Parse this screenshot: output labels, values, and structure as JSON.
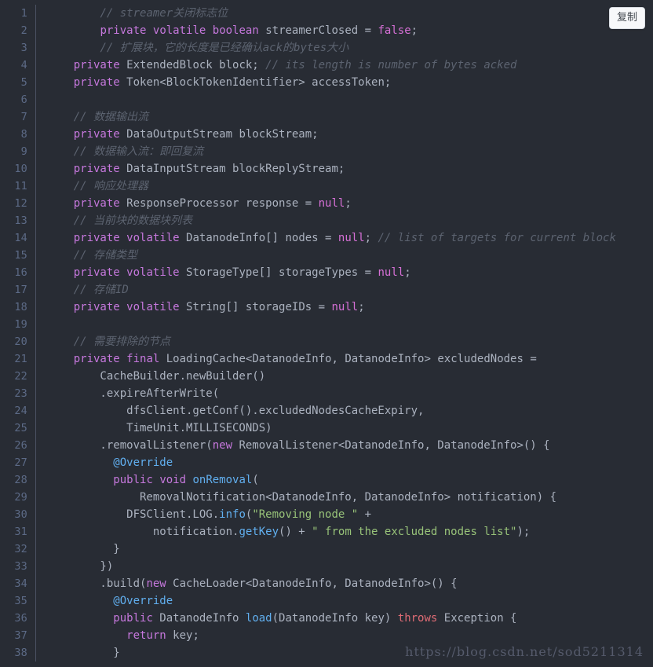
{
  "code_block": {
    "language": "java",
    "theme": {
      "background": "#282c34",
      "foreground": "#abb2bf",
      "gutter_text": "#5c6a86",
      "gutter_border": "#4b5263",
      "keyword": "#c678dd",
      "comment": "#5c6370",
      "string": "#98c379",
      "function": "#61afef",
      "annotation": "#61afef",
      "literal": "#d670d6"
    },
    "copy_button": {
      "label": "复制"
    },
    "watermark": {
      "text": "https://blog.csdn.net/sod5211314"
    },
    "line_numbers": [
      "1",
      "2",
      "3",
      "4",
      "5",
      "6",
      "7",
      "8",
      "9",
      "10",
      "11",
      "12",
      "13",
      "14",
      "15",
      "16",
      "17",
      "18",
      "19",
      "20",
      "21",
      "22",
      "23",
      "24",
      "25",
      "26",
      "27",
      "28",
      "29",
      "30",
      "31",
      "32",
      "33",
      "34",
      "35",
      "36",
      "37",
      "38"
    ],
    "lines": [
      "        // streamer关闭标志位",
      "        private volatile boolean streamerClosed = false;",
      "        // 扩展块，它的长度是已经确认ack的bytes大小",
      "    private ExtendedBlock block; // its length is number of bytes acked",
      "    private Token<BlockTokenIdentifier> accessToken;",
      "",
      "    // 数据输出流",
      "    private DataOutputStream blockStream;",
      "    // 数据输入流：即回复流",
      "    private DataInputStream blockReplyStream;",
      "    // 响应处理器",
      "    private ResponseProcessor response = null;",
      "    // 当前块的数据块列表",
      "    private volatile DatanodeInfo[] nodes = null; // list of targets for current block",
      "    // 存储类型",
      "    private volatile StorageType[] storageTypes = null;",
      "    // 存储ID",
      "    private volatile String[] storageIDs = null;",
      "",
      "    // 需要排除的节点",
      "    private final LoadingCache<DatanodeInfo, DatanodeInfo> excludedNodes =",
      "        CacheBuilder.newBuilder()",
      "        .expireAfterWrite(",
      "            dfsClient.getConf().excludedNodesCacheExpiry,",
      "            TimeUnit.MILLISECONDS)",
      "        .removalListener(new RemovalListener<DatanodeInfo, DatanodeInfo>() {",
      "          @Override",
      "          public void onRemoval(",
      "              RemovalNotification<DatanodeInfo, DatanodeInfo> notification) {",
      "            DFSClient.LOG.info(\"Removing node \" +",
      "                notification.getKey() + \" from the excluded nodes list\");",
      "          }",
      "        })",
      "        .build(new CacheLoader<DatanodeInfo, DatanodeInfo>() {",
      "          @Override",
      "          public DatanodeInfo load(DatanodeInfo key) throws Exception {",
      "            return key;",
      "          }"
    ],
    "tokens": [
      [
        {
          "t": "        ",
          "c": "plain"
        },
        {
          "t": "// streamer关闭标志位",
          "c": "cmt"
        }
      ],
      [
        {
          "t": "        ",
          "c": "plain"
        },
        {
          "t": "private",
          "c": "kw"
        },
        {
          "t": " ",
          "c": "plain"
        },
        {
          "t": "volatile",
          "c": "kw"
        },
        {
          "t": " ",
          "c": "plain"
        },
        {
          "t": "boolean",
          "c": "kw"
        },
        {
          "t": " streamerClosed = ",
          "c": "plain"
        },
        {
          "t": "false",
          "c": "lit"
        },
        {
          "t": ";",
          "c": "plain"
        }
      ],
      [
        {
          "t": "        ",
          "c": "plain"
        },
        {
          "t": "// 扩展块，它的长度是已经确认ack的bytes大小",
          "c": "cmt"
        }
      ],
      [
        {
          "t": "    ",
          "c": "plain"
        },
        {
          "t": "private",
          "c": "kw"
        },
        {
          "t": " ExtendedBlock block; ",
          "c": "plain"
        },
        {
          "t": "// its length is number of bytes acked",
          "c": "cmt"
        }
      ],
      [
        {
          "t": "    ",
          "c": "plain"
        },
        {
          "t": "private",
          "c": "kw"
        },
        {
          "t": " Token<BlockTokenIdentifier> accessToken;",
          "c": "plain"
        }
      ],
      [
        {
          "t": "",
          "c": "plain"
        }
      ],
      [
        {
          "t": "    ",
          "c": "plain"
        },
        {
          "t": "// 数据输出流",
          "c": "cmt"
        }
      ],
      [
        {
          "t": "    ",
          "c": "plain"
        },
        {
          "t": "private",
          "c": "kw"
        },
        {
          "t": " DataOutputStream blockStream;",
          "c": "plain"
        }
      ],
      [
        {
          "t": "    ",
          "c": "plain"
        },
        {
          "t": "// 数据输入流：即回复流",
          "c": "cmt"
        }
      ],
      [
        {
          "t": "    ",
          "c": "plain"
        },
        {
          "t": "private",
          "c": "kw"
        },
        {
          "t": " DataInputStream blockReplyStream;",
          "c": "plain"
        }
      ],
      [
        {
          "t": "    ",
          "c": "plain"
        },
        {
          "t": "// 响应处理器",
          "c": "cmt"
        }
      ],
      [
        {
          "t": "    ",
          "c": "plain"
        },
        {
          "t": "private",
          "c": "kw"
        },
        {
          "t": " ResponseProcessor response = ",
          "c": "plain"
        },
        {
          "t": "null",
          "c": "lit"
        },
        {
          "t": ";",
          "c": "plain"
        }
      ],
      [
        {
          "t": "    ",
          "c": "plain"
        },
        {
          "t": "// 当前块的数据块列表",
          "c": "cmt"
        }
      ],
      [
        {
          "t": "    ",
          "c": "plain"
        },
        {
          "t": "private",
          "c": "kw"
        },
        {
          "t": " ",
          "c": "plain"
        },
        {
          "t": "volatile",
          "c": "kw"
        },
        {
          "t": " DatanodeInfo[] nodes = ",
          "c": "plain"
        },
        {
          "t": "null",
          "c": "lit"
        },
        {
          "t": "; ",
          "c": "plain"
        },
        {
          "t": "// list of targets for current block",
          "c": "cmt"
        }
      ],
      [
        {
          "t": "    ",
          "c": "plain"
        },
        {
          "t": "// 存储类型",
          "c": "cmt"
        }
      ],
      [
        {
          "t": "    ",
          "c": "plain"
        },
        {
          "t": "private",
          "c": "kw"
        },
        {
          "t": " ",
          "c": "plain"
        },
        {
          "t": "volatile",
          "c": "kw"
        },
        {
          "t": " StorageType[] storageTypes = ",
          "c": "plain"
        },
        {
          "t": "null",
          "c": "lit"
        },
        {
          "t": ";",
          "c": "plain"
        }
      ],
      [
        {
          "t": "    ",
          "c": "plain"
        },
        {
          "t": "// 存储ID",
          "c": "cmt"
        }
      ],
      [
        {
          "t": "    ",
          "c": "plain"
        },
        {
          "t": "private",
          "c": "kw"
        },
        {
          "t": " ",
          "c": "plain"
        },
        {
          "t": "volatile",
          "c": "kw"
        },
        {
          "t": " String[] storageIDs = ",
          "c": "plain"
        },
        {
          "t": "null",
          "c": "lit"
        },
        {
          "t": ";",
          "c": "plain"
        }
      ],
      [
        {
          "t": "",
          "c": "plain"
        }
      ],
      [
        {
          "t": "    ",
          "c": "plain"
        },
        {
          "t": "// 需要排除的节点",
          "c": "cmt"
        }
      ],
      [
        {
          "t": "    ",
          "c": "plain"
        },
        {
          "t": "private",
          "c": "kw"
        },
        {
          "t": " ",
          "c": "plain"
        },
        {
          "t": "final",
          "c": "kw"
        },
        {
          "t": " LoadingCache<DatanodeInfo, DatanodeInfo> excludedNodes =",
          "c": "plain"
        }
      ],
      [
        {
          "t": "        CacheBuilder.newBuilder()",
          "c": "plain"
        }
      ],
      [
        {
          "t": "        .expireAfterWrite(",
          "c": "plain"
        }
      ],
      [
        {
          "t": "            dfsClient.getConf().excludedNodesCacheExpiry,",
          "c": "plain"
        }
      ],
      [
        {
          "t": "            TimeUnit.MILLISECONDS)",
          "c": "plain"
        }
      ],
      [
        {
          "t": "        .removalListener(",
          "c": "plain"
        },
        {
          "t": "new",
          "c": "kw"
        },
        {
          "t": " RemovalListener<DatanodeInfo, DatanodeInfo>() {",
          "c": "plain"
        }
      ],
      [
        {
          "t": "          ",
          "c": "plain"
        },
        {
          "t": "@Override",
          "c": "ann"
        }
      ],
      [
        {
          "t": "          ",
          "c": "plain"
        },
        {
          "t": "public",
          "c": "kw"
        },
        {
          "t": " ",
          "c": "plain"
        },
        {
          "t": "void",
          "c": "kw"
        },
        {
          "t": " ",
          "c": "plain"
        },
        {
          "t": "onRemoval",
          "c": "fn"
        },
        {
          "t": "(",
          "c": "plain"
        }
      ],
      [
        {
          "t": "              RemovalNotification<DatanodeInfo, DatanodeInfo> notification) {",
          "c": "plain"
        }
      ],
      [
        {
          "t": "            DFSClient.LOG.",
          "c": "plain"
        },
        {
          "t": "info",
          "c": "fn"
        },
        {
          "t": "(",
          "c": "plain"
        },
        {
          "t": "\"Removing node \"",
          "c": "str"
        },
        {
          "t": " +",
          "c": "plain"
        }
      ],
      [
        {
          "t": "                notification.",
          "c": "plain"
        },
        {
          "t": "getKey",
          "c": "fn"
        },
        {
          "t": "() + ",
          "c": "plain"
        },
        {
          "t": "\" from the excluded nodes list\"",
          "c": "str"
        },
        {
          "t": ");",
          "c": "plain"
        }
      ],
      [
        {
          "t": "          }",
          "c": "plain"
        }
      ],
      [
        {
          "t": "        })",
          "c": "plain"
        }
      ],
      [
        {
          "t": "        .build(",
          "c": "plain"
        },
        {
          "t": "new",
          "c": "kw"
        },
        {
          "t": " CacheLoader<DatanodeInfo, DatanodeInfo>() {",
          "c": "plain"
        }
      ],
      [
        {
          "t": "          ",
          "c": "plain"
        },
        {
          "t": "@Override",
          "c": "ann"
        }
      ],
      [
        {
          "t": "          ",
          "c": "plain"
        },
        {
          "t": "public",
          "c": "kw"
        },
        {
          "t": " DatanodeInfo ",
          "c": "plain"
        },
        {
          "t": "load",
          "c": "fn"
        },
        {
          "t": "(DatanodeInfo key) ",
          "c": "plain"
        },
        {
          "t": "throws",
          "c": "kw2"
        },
        {
          "t": " Exception {",
          "c": "plain"
        }
      ],
      [
        {
          "t": "            ",
          "c": "plain"
        },
        {
          "t": "return",
          "c": "kw"
        },
        {
          "t": " key;",
          "c": "plain"
        }
      ],
      [
        {
          "t": "          }",
          "c": "plain"
        }
      ]
    ]
  }
}
